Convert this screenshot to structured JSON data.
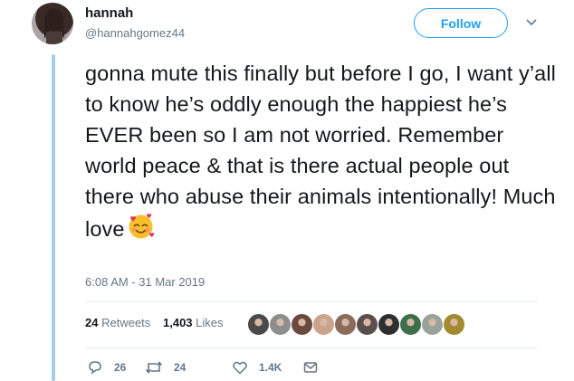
{
  "user": {
    "display_name": "hannah",
    "handle": "@hannahgomez44",
    "avatar_icon": "profile-photo"
  },
  "follow_button": {
    "label": "Follow"
  },
  "caret_icon": "chevron-down-icon",
  "tweet": {
    "text": "gonna mute this finally but before I go, I want y’all to know he’s oddly enough the happiest he’s EVER been so I am not worried. Remember world peace & that is there actual people out there who abuse their animals intentionally! Much love",
    "emoji": "smiling-face-with-hearts",
    "timestamp": "6:08 AM - 31 Mar 2019"
  },
  "stats": {
    "retweets_count": "24",
    "retweets_label": "Retweets",
    "likes_count": "1,403",
    "likes_label": "Likes"
  },
  "likers": [
    {
      "name": "liker-avatar-1",
      "color": "#4a4a4a"
    },
    {
      "name": "liker-avatar-2",
      "color": "#8d8d8d"
    },
    {
      "name": "liker-avatar-3",
      "color": "#6b4a3e"
    },
    {
      "name": "liker-avatar-4",
      "color": "#c9a48b"
    },
    {
      "name": "liker-avatar-5",
      "color": "#8a6b5c"
    },
    {
      "name": "liker-avatar-6",
      "color": "#5a4f4d"
    },
    {
      "name": "liker-avatar-7",
      "color": "#2f2f2f"
    },
    {
      "name": "liker-avatar-8",
      "color": "#3f6e4a"
    },
    {
      "name": "liker-avatar-9",
      "color": "#9aa39a"
    },
    {
      "name": "liker-avatar-10",
      "color": "#a48a2f"
    }
  ],
  "actions": {
    "reply_count": "26",
    "retweet_count": "24",
    "like_count": "1.4K"
  },
  "colors": {
    "accent": "#1da1f2",
    "thread_line": "#a3ceea",
    "muted_text": "#657786"
  }
}
